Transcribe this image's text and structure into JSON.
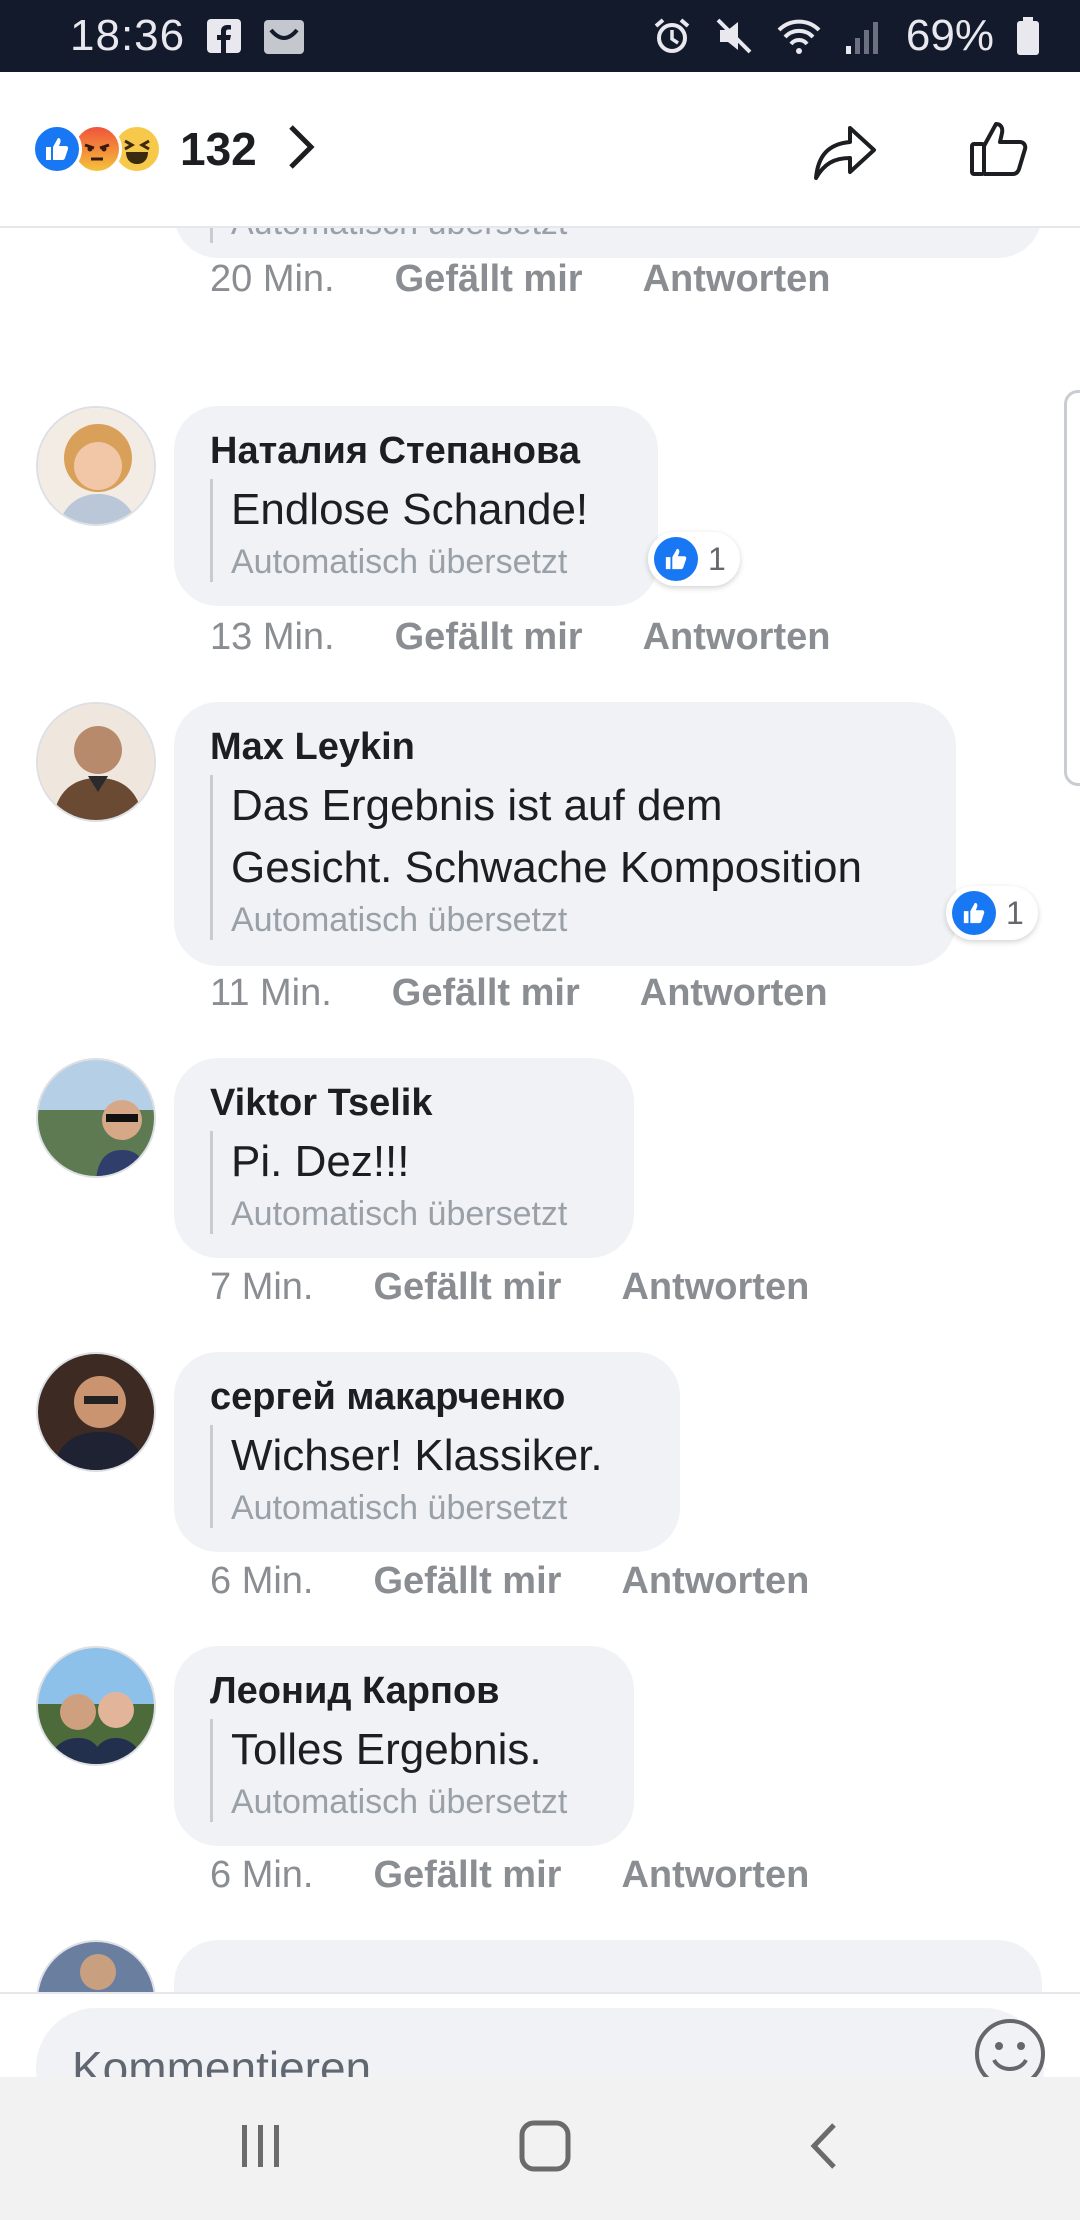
{
  "status_bar": {
    "time": "18:36",
    "battery": "69%"
  },
  "header": {
    "reaction_count": "132"
  },
  "comments": [
    {
      "author": "",
      "text": "",
      "translated": "Automatisch übersetzt",
      "time": "20 Min.",
      "like": "Gefällt mir",
      "reply": "Antworten"
    },
    {
      "author": "Наталия Степанова",
      "text": "Endlose Schande!",
      "translated": "Automatisch übersetzt",
      "time": "13 Min.",
      "like": "Gefällt mir",
      "reply": "Antworten",
      "likes": "1"
    },
    {
      "author": "Max Leykin",
      "text_line1": "Das Ergebnis ist auf dem",
      "text_line2": "Gesicht. Schwache Komposition",
      "translated": "Automatisch übersetzt",
      "time": "11 Min.",
      "like": "Gefällt mir",
      "reply": "Antworten",
      "likes": "1"
    },
    {
      "author": "Viktor  Tselik",
      "text": "Pi. Dez!!!",
      "translated": "Automatisch übersetzt",
      "time": "7 Min.",
      "like": "Gefällt mir",
      "reply": "Antworten"
    },
    {
      "author": "сергей макарченко",
      "text": "Wichser! Klassiker.",
      "translated": "Automatisch übersetzt",
      "time": "6 Min.",
      "like": "Gefällt mir",
      "reply": "Antworten"
    },
    {
      "author": "Леонид Карпов",
      "text": "Tolles Ergebnis.",
      "translated": "Automatisch übersetzt",
      "time": "6 Min.",
      "like": "Gefällt mir",
      "reply": "Antworten"
    }
  ],
  "composer": {
    "placeholder": "Kommentieren ..."
  },
  "icons": {
    "status": [
      "facebook-icon",
      "photo-icon",
      "alarm-icon",
      "mute-icon",
      "wifi-icon",
      "signal-icon",
      "battery-icon"
    ],
    "header": [
      "like-reaction-icon",
      "angry-reaction-icon",
      "haha-reaction-icon",
      "chevron-right-icon",
      "share-icon",
      "thumbs-up-icon"
    ],
    "nav": [
      "recent-apps-icon",
      "home-icon",
      "back-icon"
    ]
  },
  "colors": {
    "status_bg": "#131a2b",
    "bubble": "#f0f2f5",
    "accent": "#1877f2"
  }
}
